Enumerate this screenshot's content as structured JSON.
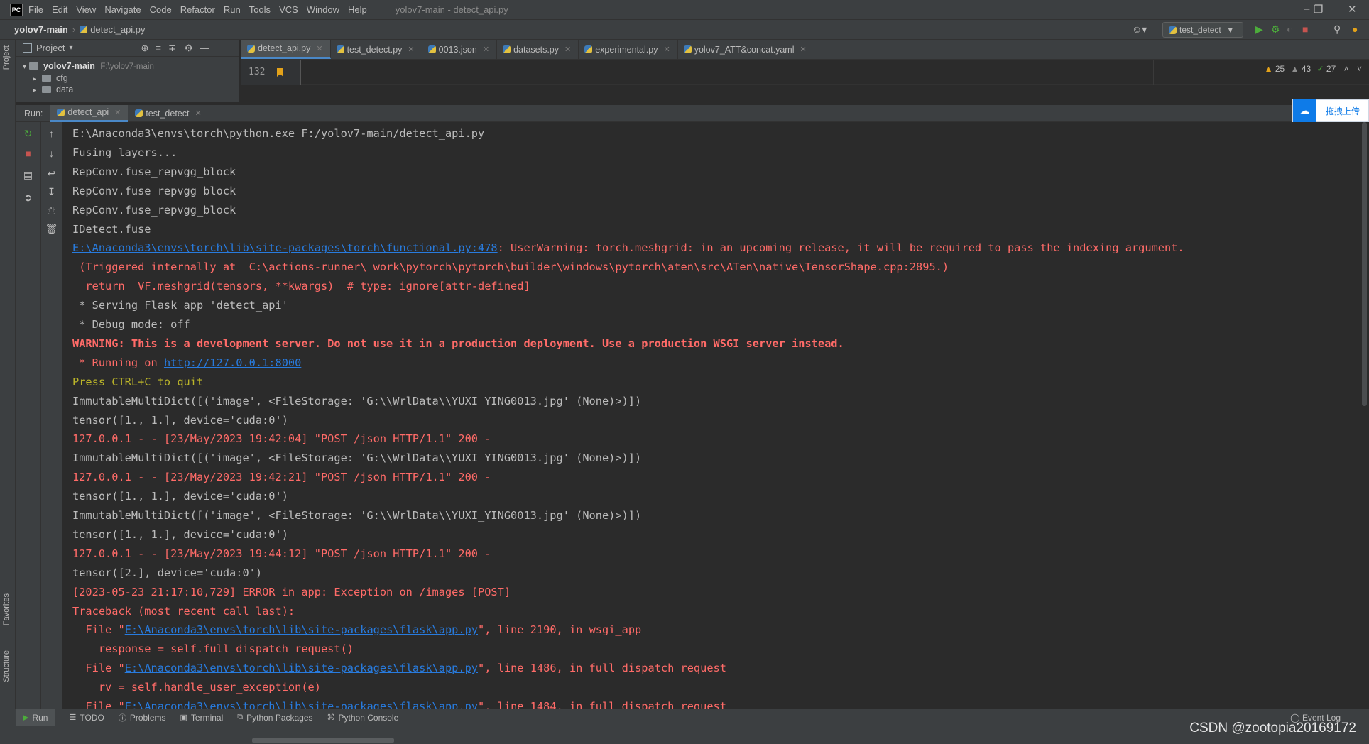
{
  "app": {
    "logo_text": "PC",
    "menu": [
      "File",
      "Edit",
      "View",
      "Navigate",
      "Code",
      "Refactor",
      "Run",
      "Tools",
      "VCS",
      "Window",
      "Help"
    ],
    "window_title": "yolov7-main - detect_api.py"
  },
  "navbar": {
    "project": "yolov7-main",
    "file": "detect_api.py",
    "run_config": "test_detect"
  },
  "project_panel": {
    "title": "Project",
    "root_name": "yolov7-main",
    "root_path": "F:\\yolov7-main",
    "folders": [
      "cfg",
      "data"
    ]
  },
  "editor_tabs": [
    {
      "label": "detect_api.py",
      "active": true
    },
    {
      "label": "test_detect.py",
      "active": false
    },
    {
      "label": "0013.json",
      "active": false
    },
    {
      "label": "datasets.py",
      "active": false
    },
    {
      "label": "experimental.py",
      "active": false
    },
    {
      "label": "yolov7_ATT&concat.yaml",
      "active": false
    }
  ],
  "editor": {
    "line_number": "132",
    "warnings": "25",
    "weak_warnings": "43",
    "typos": "27"
  },
  "run_panel": {
    "label": "Run:",
    "tabs": [
      {
        "label": "detect_api",
        "active": true
      },
      {
        "label": "test_detect",
        "active": false
      }
    ]
  },
  "baidu_upload": {
    "label": "拖拽上传"
  },
  "console": {
    "lines": [
      [
        {
          "t": "E:\\Anaconda3\\envs\\torch\\python.exe F:/yolov7-main/detect_api.py",
          "c": "std"
        }
      ],
      [
        {
          "t": "Fusing layers...",
          "c": "std"
        }
      ],
      [
        {
          "t": "RepConv.fuse_repvgg_block",
          "c": "std"
        }
      ],
      [
        {
          "t": "RepConv.fuse_repvgg_block",
          "c": "std"
        }
      ],
      [
        {
          "t": "RepConv.fuse_repvgg_block",
          "c": "std"
        }
      ],
      [
        {
          "t": "IDetect.fuse",
          "c": "std"
        }
      ],
      [
        {
          "t": "E:\\Anaconda3\\envs\\torch\\lib\\site-packages\\torch\\functional.py:478",
          "c": "link"
        },
        {
          "t": ": UserWarning: torch.meshgrid: in an upcoming release, it will be required to pass the indexing argument.",
          "c": "err"
        }
      ],
      [
        {
          "t": " (Triggered internally at  C:\\actions-runner\\_work\\pytorch\\pytorch\\builder\\windows\\pytorch\\aten\\src\\ATen\\native\\TensorShape.cpp:2895.)",
          "c": "err"
        }
      ],
      [
        {
          "t": "  return _VF.meshgrid(tensors, **kwargs)  # type: ignore[attr-defined]",
          "c": "err"
        }
      ],
      [
        {
          "t": " * Serving Flask app 'detect_api'",
          "c": "std"
        }
      ],
      [
        {
          "t": " * Debug mode: off",
          "c": "std"
        }
      ],
      [
        {
          "t": "WARNING: This is a development server. Do not use it in a production deployment. Use a production WSGI server instead.",
          "c": "warn"
        }
      ],
      [
        {
          "t": " * Running on ",
          "c": "err"
        },
        {
          "t": "http://127.0.0.1:8000",
          "c": "link"
        }
      ],
      [
        {
          "t": "Press CTRL+C to quit",
          "c": "yel"
        }
      ],
      [
        {
          "t": "ImmutableMultiDict([('image', <FileStorage: 'G:\\\\WrlData\\\\YUXI_YING0013.jpg' (None)>)])",
          "c": "std"
        }
      ],
      [
        {
          "t": "tensor([1., 1.], device='cuda:0')",
          "c": "std"
        }
      ],
      [
        {
          "t": "127.0.0.1 - - [23/May/2023 19:42:04] \"POST /json HTTP/1.1\" 200 -",
          "c": "err"
        }
      ],
      [
        {
          "t": "ImmutableMultiDict([('image', <FileStorage: 'G:\\\\WrlData\\\\YUXI_YING0013.jpg' (None)>)])",
          "c": "std"
        }
      ],
      [
        {
          "t": "127.0.0.1 - - [23/May/2023 19:42:21] \"POST /json HTTP/1.1\" 200 -",
          "c": "err"
        }
      ],
      [
        {
          "t": "tensor([1., 1.], device='cuda:0')",
          "c": "std"
        }
      ],
      [
        {
          "t": "ImmutableMultiDict([('image', <FileStorage: 'G:\\\\WrlData\\\\YUXI_YING0013.jpg' (None)>)])",
          "c": "std"
        }
      ],
      [
        {
          "t": "tensor([1., 1.], device='cuda:0')",
          "c": "std"
        }
      ],
      [
        {
          "t": "127.0.0.1 - - [23/May/2023 19:44:12] \"POST /json HTTP/1.1\" 200 -",
          "c": "err"
        }
      ],
      [
        {
          "t": "tensor([2.], device='cuda:0')",
          "c": "std"
        }
      ],
      [
        {
          "t": "[2023-05-23 21:17:10,729] ERROR in app: Exception on /images [POST]",
          "c": "err"
        }
      ],
      [
        {
          "t": "Traceback (most recent call last):",
          "c": "err"
        }
      ],
      [
        {
          "t": "  File \"",
          "c": "err"
        },
        {
          "t": "E:\\Anaconda3\\envs\\torch\\lib\\site-packages\\flask\\app.py",
          "c": "link"
        },
        {
          "t": "\", line 2190, in wsgi_app",
          "c": "err"
        }
      ],
      [
        {
          "t": "    response = self.full_dispatch_request()",
          "c": "err"
        }
      ],
      [
        {
          "t": "  File \"",
          "c": "err"
        },
        {
          "t": "E:\\Anaconda3\\envs\\torch\\lib\\site-packages\\flask\\app.py",
          "c": "link"
        },
        {
          "t": "\", line 1486, in full_dispatch_request",
          "c": "err"
        }
      ],
      [
        {
          "t": "    rv = self.handle_user_exception(e)",
          "c": "err"
        }
      ],
      [
        {
          "t": "  File \"",
          "c": "err"
        },
        {
          "t": "E:\\Anaconda3\\envs\\torch\\lib\\site-packages\\flask\\app.py",
          "c": "link"
        },
        {
          "t": "\", line 1484, in full_dispatch_request",
          "c": "err"
        }
      ]
    ]
  },
  "bottom_tabs": [
    {
      "label": "Run",
      "icon": "play-icon",
      "active": true
    },
    {
      "label": "TODO",
      "icon": "list-icon",
      "active": false
    },
    {
      "label": "Problems",
      "icon": "problems-icon",
      "active": false
    },
    {
      "label": "Terminal",
      "icon": "terminal-icon",
      "active": false
    },
    {
      "label": "Python Packages",
      "icon": "packages-icon",
      "active": false
    },
    {
      "label": "Python Console",
      "icon": "console-icon",
      "active": false
    }
  ],
  "event_log": "Event Log",
  "side_labels": {
    "project": "Project",
    "favorites": "Favorites",
    "structure": "Structure"
  },
  "watermark": "CSDN @zootopia20169172",
  "colors": {
    "background": "#2b2b2b",
    "panel": "#3c3f41",
    "error_text": "#ff6b68",
    "link": "#287bde",
    "accent": "#4a88c7"
  }
}
